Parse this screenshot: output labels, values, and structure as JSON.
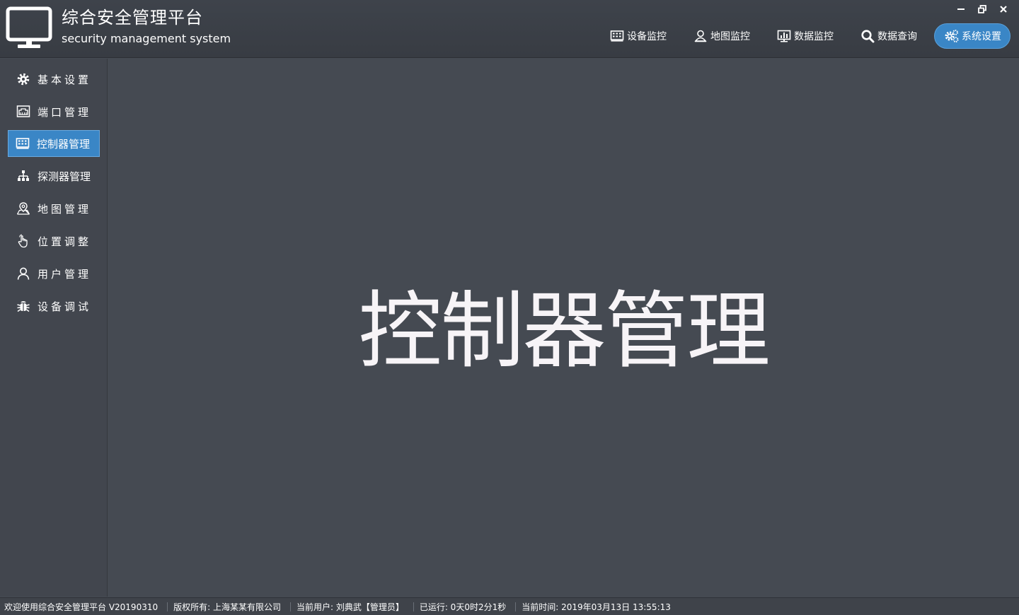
{
  "header": {
    "title": "综合安全管理平台",
    "subtitle": "security management system",
    "logo_icon": "monitor-icon",
    "nav": [
      {
        "label": "设备监控",
        "icon": "device-grid-icon",
        "active": false
      },
      {
        "label": "地图监控",
        "icon": "map-user-icon",
        "active": false
      },
      {
        "label": "数据监控",
        "icon": "chart-monitor-icon",
        "active": false
      },
      {
        "label": "数据查询",
        "icon": "search-icon",
        "active": false
      },
      {
        "label": "系统设置",
        "icon": "gears-icon",
        "active": true
      }
    ],
    "window_controls": {
      "minimize": "−",
      "restore": "⧉",
      "close": "×"
    }
  },
  "sidebar": {
    "items": [
      {
        "label": "基本设置",
        "icon": "gear-icon",
        "active": false
      },
      {
        "label": "端口管理",
        "icon": "port-icon",
        "active": false
      },
      {
        "label": "控制器管理",
        "icon": "controller-icon",
        "active": true
      },
      {
        "label": "探测器管理",
        "icon": "sitemap-icon",
        "active": false
      },
      {
        "label": "地图管理",
        "icon": "map-pin-icon",
        "active": false
      },
      {
        "label": "位置调整",
        "icon": "hand-pointer-icon",
        "active": false
      },
      {
        "label": "用户管理",
        "icon": "user-icon",
        "active": false
      },
      {
        "label": "设备调试",
        "icon": "bug-icon",
        "active": false
      }
    ]
  },
  "main": {
    "title": "控制器管理"
  },
  "statusbar": {
    "welcome": "欢迎使用综合安全管理平台 V20190310",
    "copyright": "版权所有: 上海某某有限公司",
    "current_user": "当前用户: 刘典武【管理员】",
    "uptime": "已运行: 0天0时2分1秒",
    "current_time": "当前时间: 2019年03月13日 13:55:13"
  },
  "colors": {
    "background": "#454a52",
    "header": "#3c4047",
    "accent": "#3a86c6",
    "text": "#ffffff"
  }
}
